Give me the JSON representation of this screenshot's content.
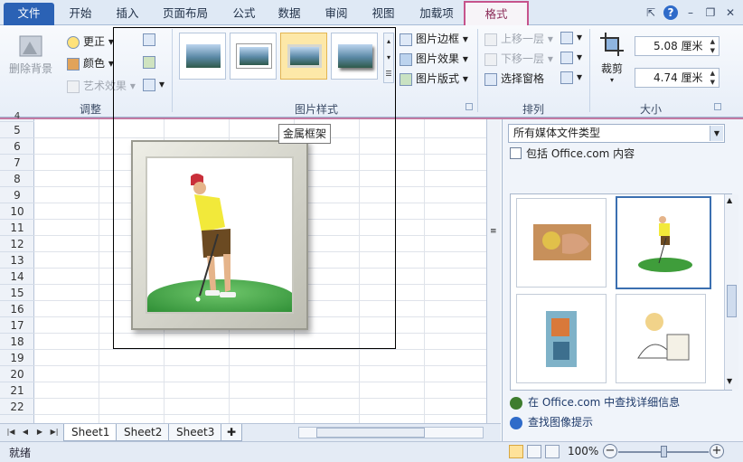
{
  "tabs": [
    "文件",
    "开始",
    "插入",
    "页面布局",
    "公式",
    "数据",
    "审阅",
    "视图",
    "加载项",
    "格式"
  ],
  "window_buttons": {
    "help": "?",
    "minimize": "–",
    "restore": "❐",
    "close": "✕"
  },
  "ribbon": {
    "adjust": {
      "remove_bg": "删除背景",
      "corrections": "更正",
      "color": "颜色",
      "artistic": "艺术效果",
      "label": "调整"
    },
    "styles": {
      "label": "图片样式",
      "border": "图片边框",
      "effects": "图片效果",
      "layout": "图片版式"
    },
    "arrange": {
      "bring_forward": "上移一层",
      "send_backward": "下移一层",
      "selection_pane": "选择窗格",
      "label": "排列"
    },
    "size": {
      "crop": "裁剪",
      "height": "5.08 厘米",
      "width": "4.74 厘米",
      "label": "大小"
    }
  },
  "tooltip": "金属框架",
  "rows": [
    "4",
    "5",
    "6",
    "7",
    "8",
    "9",
    "10",
    "11",
    "12",
    "13",
    "14",
    "15",
    "16",
    "17",
    "18",
    "19",
    "20",
    "21",
    "22"
  ],
  "sheets": [
    "Sheet1",
    "Sheet2",
    "Sheet3"
  ],
  "status": {
    "text": "就绪",
    "zoom": "100%",
    "zoom_value": 100
  },
  "pane": {
    "media_type": "所有媒体文件类型",
    "include_office": "包括 Office.com 内容",
    "link_more": "在 Office.com 中查找详细信息",
    "link_tips": "查找图像提示"
  },
  "colors": {
    "file_tab": "#2b62b5",
    "format_tab_border": "#c6538c",
    "accent": "#3b6fb0"
  }
}
